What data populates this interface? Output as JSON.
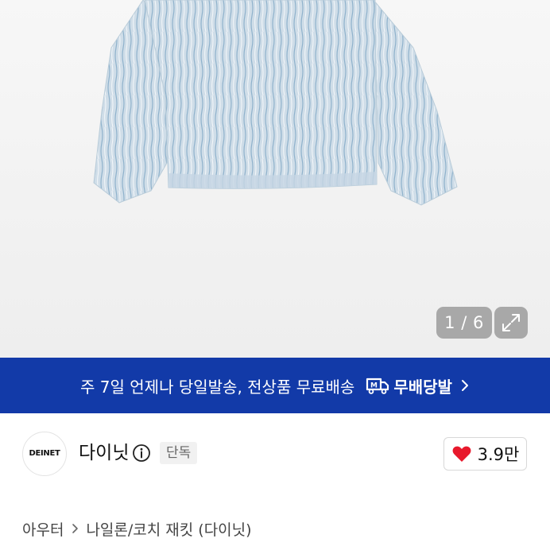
{
  "gallery": {
    "counter": "1 / 6",
    "expand_icon": "expand-icon"
  },
  "banner": {
    "text": "주 7일 언제나 당일발송, 전상품 무료배송",
    "badge": "무배당발",
    "badge_icon": "delivery-truck-icon",
    "chevron_icon": "chevron-right-icon",
    "background": "#123aa8"
  },
  "brand": {
    "logo_text": "DEINET",
    "name": "다이닛",
    "info_icon": "info-icon",
    "exclusive": "단독",
    "like_icon": "heart-icon",
    "like_color": "#e8192c",
    "like_count": "3.9만"
  },
  "breadcrumb": {
    "category": "아우터",
    "subcategory": "나일론/코치 재킷 (다이닛)"
  }
}
